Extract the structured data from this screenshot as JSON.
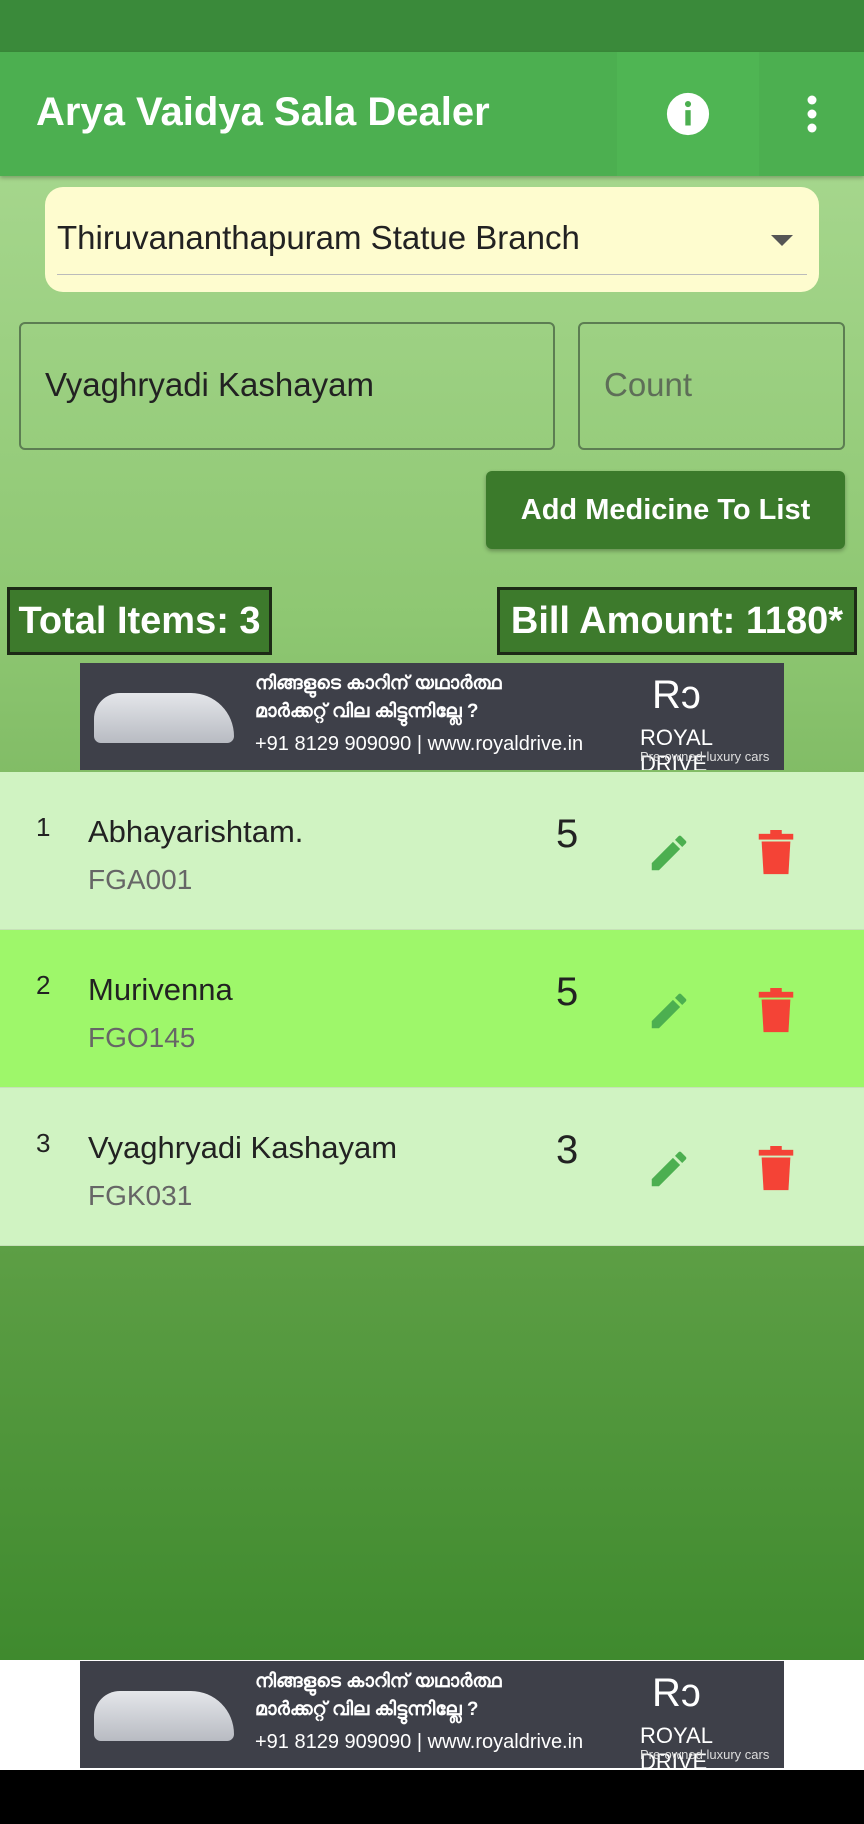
{
  "app": {
    "title": "Arya Vaidya Sala Dealer",
    "info_icon": "info-icon",
    "menu_icon": "more-vert-icon"
  },
  "branch": {
    "selected": "Thiruvananthapuram Statue Branch"
  },
  "form": {
    "medicine_value": "Vyaghryadi Kashayam",
    "count_placeholder": "Count",
    "add_button": "Add Medicine To List"
  },
  "summary": {
    "total_items": "Total Items: 3",
    "bill_amount": "Bill Amount: 1180*"
  },
  "ad": {
    "line1": "നിങ്ങളുടെ കാറിന് യഥാർത്ഥ",
    "line2": "മാർക്കറ്റ് വില കിട്ടുന്നില്ലേ ?",
    "contact": "+91 8129 909090 | www.royaldrive.in",
    "logo": "Rↄ",
    "brand": "ROYAL DRIVE",
    "tagline": "Pre-owned luxury cars"
  },
  "items": [
    {
      "index": "1",
      "name": "Abhayarishtam.",
      "code": "FGA001",
      "count": "5"
    },
    {
      "index": "2",
      "name": "Murivenna",
      "code": "FGO145",
      "count": "5"
    },
    {
      "index": "3",
      "name": "Vyaghryadi Kashayam",
      "code": "FGK031",
      "count": "3"
    }
  ],
  "colors": {
    "appbar": "#4caf50",
    "edit": "#4caf50",
    "delete": "#f44336",
    "row": "#d0f3c2",
    "row_highlight": "#9ef76a"
  }
}
